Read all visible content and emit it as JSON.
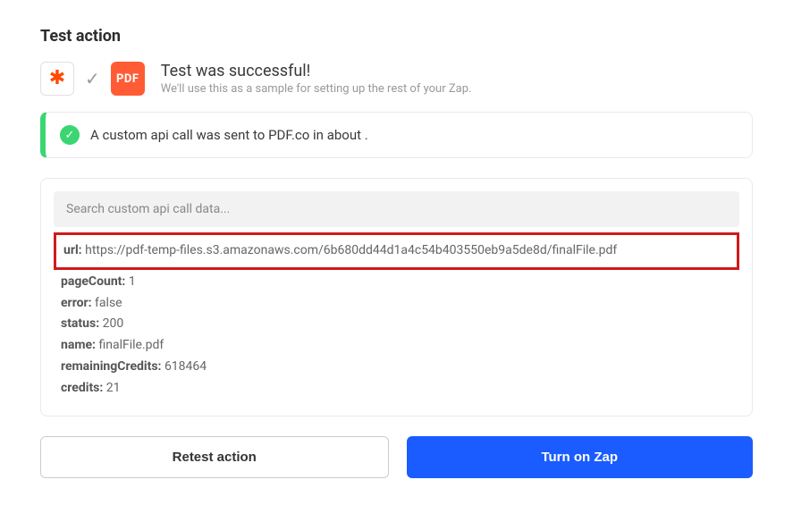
{
  "title": "Test action",
  "header": {
    "zapier_icon": "✱",
    "check_icon": "✓",
    "pdf_label": "PDF",
    "success_title": "Test was successful!",
    "success_sub": "We'll use this as a sample for setting up the rest of your Zap."
  },
  "banner": {
    "check": "✓",
    "text": "A custom api call was sent to PDF.co in about ."
  },
  "search": {
    "placeholder": "Search custom api call data..."
  },
  "result": {
    "url_key": "url:",
    "url_value": "https://pdf-temp-files.s3.amazonaws.com/6b680dd44d1a4c54b403550eb9a5de8d/finalFile.pdf",
    "rows": [
      {
        "key": "pageCount:",
        "value": "1"
      },
      {
        "key": "error:",
        "value": "false"
      },
      {
        "key": "status:",
        "value": "200"
      },
      {
        "key": "name:",
        "value": "finalFile.pdf"
      },
      {
        "key": "remainingCredits:",
        "value": "618464"
      },
      {
        "key": "credits:",
        "value": "21"
      }
    ]
  },
  "buttons": {
    "retest": "Retest action",
    "turnon": "Turn on Zap"
  }
}
